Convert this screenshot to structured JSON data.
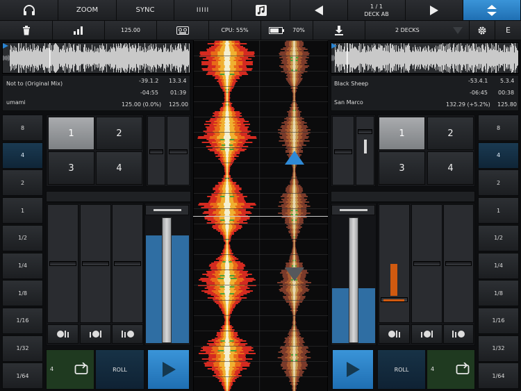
{
  "toolbar": {
    "headphones": "headphones-icon",
    "zoom": "ZOOM",
    "sync": "SYNC",
    "bars": "IIIII",
    "music": "music-note-icon",
    "deck_page": "1 / 1",
    "deck_name": "DECK AB",
    "collapse": "collapse-arrows-icon"
  },
  "statusbar": {
    "trash": "trash-icon",
    "levels": "signal-bars-icon",
    "bpm": "125.00",
    "cassette": "cassette-icon",
    "cpu": "CPU: 55%",
    "battery": "70%",
    "download": "download-icon",
    "decks": "2 DECKS",
    "settings": "gear-icon",
    "edit": "E"
  },
  "deck_a": {
    "title": "Not to (Original Mix)",
    "artist": "umami",
    "pos": "-39.1.2",
    "bar_pos": "13.3.4",
    "remain": "-04:55",
    "elapsed": "01:39",
    "pitch": "125.00 (0.0%)",
    "bpm": "125.00",
    "loop_beats": "4",
    "roll": "ROLL",
    "level": 0.88
  },
  "deck_b": {
    "title": "Black Sheep",
    "artist": "San Marco",
    "pos": "-53.4.1",
    "bar_pos": "5.3.4",
    "remain": "-06:45",
    "elapsed": "00:38",
    "pitch": "132.29 (+5.2%)",
    "bpm": "125.80",
    "loop_beats": "4",
    "roll": "ROLL",
    "level": 0.45
  },
  "beats": [
    "8",
    "4",
    "2",
    "1",
    "1/2",
    "1/4",
    "1/8",
    "1/16",
    "1/32",
    "1/64"
  ],
  "pads": [
    "1",
    "2",
    "3",
    "4"
  ],
  "colors": {
    "accent": "#2a84d2",
    "loop_green": "#1f3a20",
    "waveform_red": "#e02a20"
  }
}
